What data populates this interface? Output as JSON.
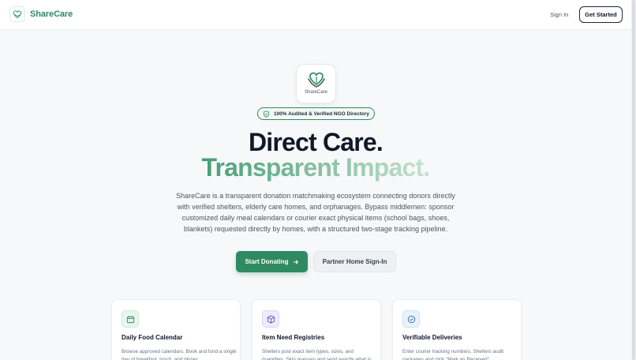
{
  "navbar": {
    "brand_name": "ShareCare",
    "signin_label": "Sign In",
    "getstarted_label": "Get Started"
  },
  "hero": {
    "logo_text": "ShareCare",
    "badge_text": "100% Audited & Verified NGO Directory",
    "headline_line1": "Direct Care.",
    "headline_line2": "Transparent Impact.",
    "description": "ShareCare is a transparent donation matchmaking ecosystem connecting donors directly with verified shelters, elderly care homes, and orphanages. Bypass middlemen: sponsor customized daily meal calendars or courier exact physical items (school bags, shoes, blankets) requested directly by homes, with a structured two-stage tracking pipeline.",
    "primary_button": "Start Donating",
    "secondary_button": "Partner Home Sign-In"
  },
  "features": [
    {
      "icon": "calendar-icon",
      "title": "Daily Food Calendar",
      "body": "Browse approved calendars. Book and fund a single day of breakfast, lunch, and dinner."
    },
    {
      "icon": "box-icon",
      "title": "Item Need Registries",
      "body": "Shelters post exact item types, sizes, and quantities. Skip guesses and send exactly what is needed."
    },
    {
      "icon": "check-circle-icon",
      "title": "Verifiable Deliveries",
      "body": "Enter courier tracking numbers. Shelters audit packages and click \"Mark as Received\"."
    }
  ],
  "colors": {
    "brand_green": "#2f8a62",
    "headline_dark": "#111827",
    "background": "#f7f8f9",
    "calendar_icon_bg": "#e8f6ee",
    "box_icon_bg": "#efeafc",
    "check_icon_bg": "#e7f2fb"
  }
}
